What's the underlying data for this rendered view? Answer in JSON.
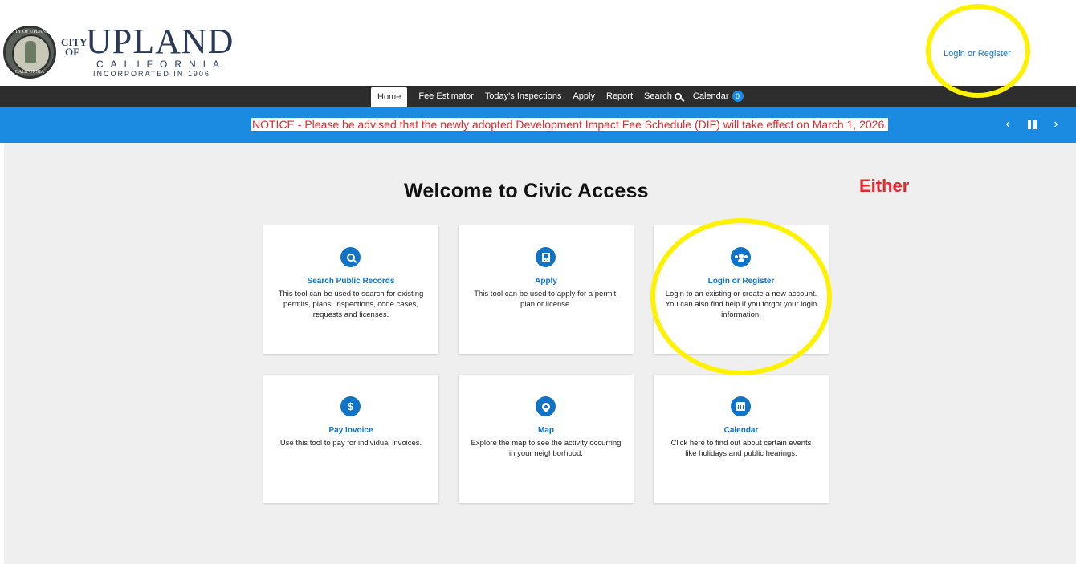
{
  "header": {
    "logo": {
      "seal_top": "CITY OF UPLAND",
      "seal_bottom": "CALIFORNIA",
      "city_of": "CITY OF",
      "name": "UPLAND",
      "state": "CALIFORNIA",
      "incorporated": "INCORPORATED IN 1906"
    },
    "login_link": "Login or Register"
  },
  "nav": {
    "items": [
      {
        "label": "Home",
        "active": true
      },
      {
        "label": "Fee Estimator"
      },
      {
        "label": "Today's Inspections"
      },
      {
        "label": "Apply"
      },
      {
        "label": "Report"
      },
      {
        "label": "Search"
      },
      {
        "label": "Calendar"
      }
    ],
    "calendar_badge": "0"
  },
  "notice": {
    "text": "NOTICE - Please be advised that the newly adopted Development Impact Fee Schedule (DIF) will take effect on March 1, 2026.",
    "prev_glyph": "‹",
    "next_glyph": "›"
  },
  "main": {
    "title": "Welcome to Civic Access",
    "annotation": "Either",
    "cards": [
      {
        "icon": "search-icon",
        "title": "Search Public Records",
        "desc": "This tool can be used to search for existing permits, plans, inspections, code cases, requests and licenses."
      },
      {
        "icon": "clipboard-check-icon",
        "title": "Apply",
        "desc": "This tool can be used to apply for a permit, plan or license."
      },
      {
        "icon": "users-icon",
        "title": "Login or Register",
        "desc": "Login to an existing or create a new account. You can also find help if you forgot your login information."
      },
      {
        "icon": "dollar-icon",
        "title": "Pay Invoice",
        "desc": "Use this tool to pay for individual invoices."
      },
      {
        "icon": "map-pin-icon",
        "title": "Map",
        "desc": "Explore the map to see the activity occurring in your neighborhood."
      },
      {
        "icon": "calendar-icon",
        "title": "Calendar",
        "desc": "Click here to find out about certain events like holidays and public hearings."
      }
    ]
  },
  "colors": {
    "nav_bg": "#2d2d2d",
    "notice_bg": "#1a8be0",
    "notice_text": "#e8262b",
    "accent": "#1173c5",
    "highlight": "#fff200",
    "annotation": "#e8262b"
  }
}
